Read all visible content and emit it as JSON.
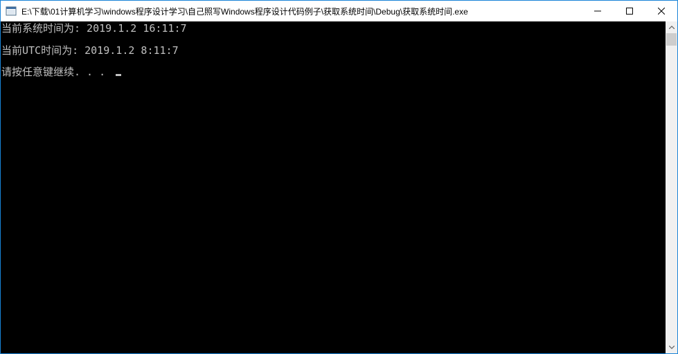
{
  "window": {
    "title": "E:\\下载\\01计算机学习\\windows程序设计学习\\自己照写Windows程序设计代码例子\\获取系统时间\\Debug\\获取系统时间.exe",
    "icon": "console-app-icon",
    "buttons": {
      "minimize": "minimize-icon",
      "maximize": "maximize-icon",
      "close": "close-icon"
    }
  },
  "console": {
    "lines": [
      "当前系统时间为: 2019.1.2 16:11:7",
      "当前UTC时间为: 2019.1.2 8:11:7",
      "请按任意键继续. . . "
    ],
    "text_color": "#c0c0c0",
    "background": "#000000"
  },
  "colors": {
    "border_accent": "#1883d7",
    "scrollbar_track": "#f0f0f0",
    "scrollbar_thumb": "#cdcdcd"
  }
}
